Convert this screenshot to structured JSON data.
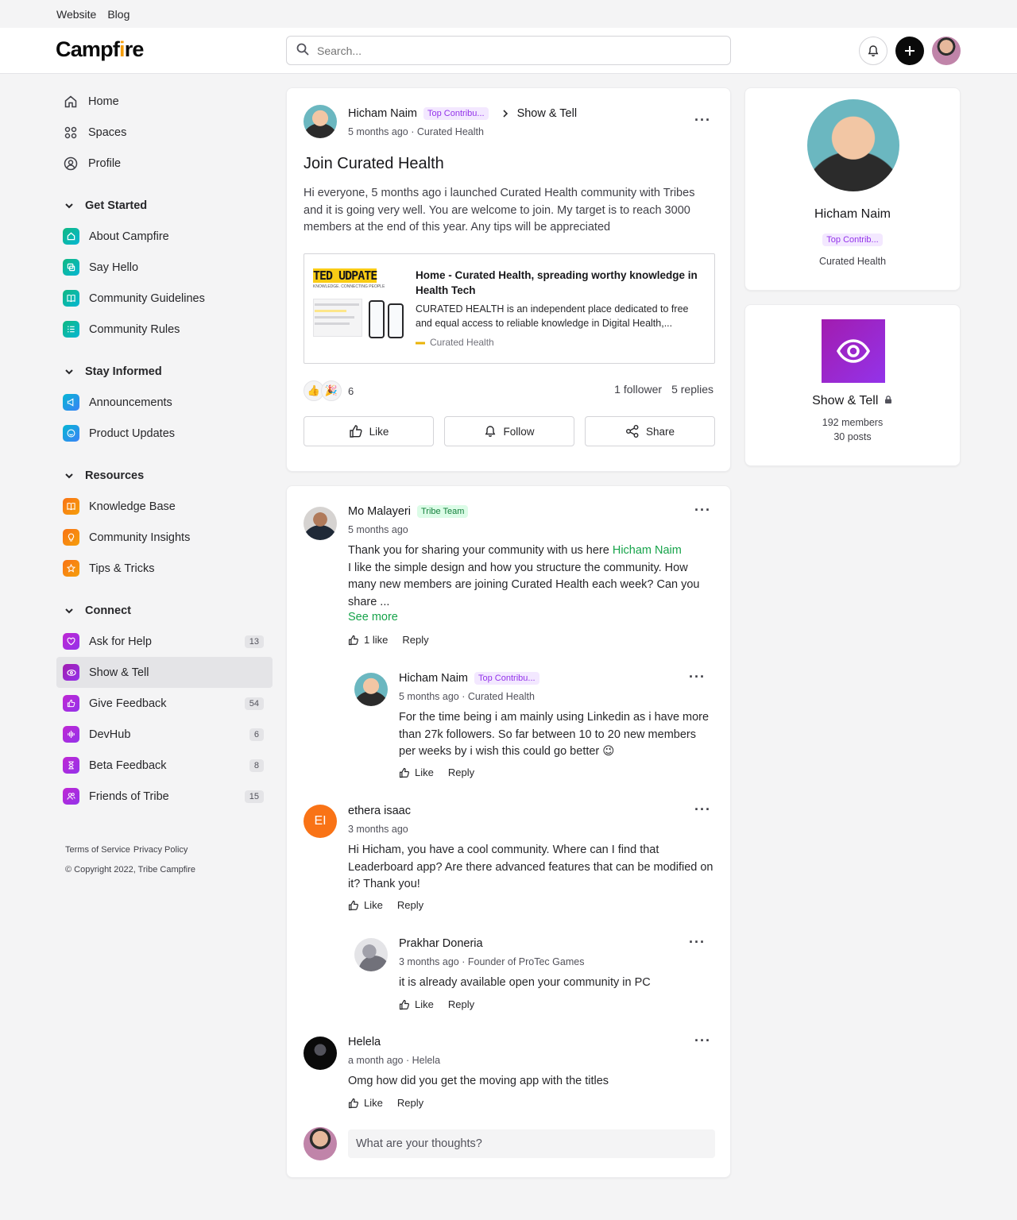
{
  "topnav": {
    "website": "Website",
    "blog": "Blog"
  },
  "header": {
    "logo": "Campfire",
    "search_placeholder": "Search..."
  },
  "sidebar": {
    "main": [
      {
        "label": "Home",
        "icon": "home-icon"
      },
      {
        "label": "Spaces",
        "icon": "grid-icon"
      },
      {
        "label": "Profile",
        "icon": "profile-icon"
      }
    ],
    "sections": [
      {
        "title": "Get Started",
        "items": [
          {
            "label": "About Campfire",
            "color": "#14b8a6"
          },
          {
            "label": "Say Hello",
            "color": "#14b8a6"
          },
          {
            "label": "Community Guidelines",
            "color": "#14b8a6"
          },
          {
            "label": "Community Rules",
            "color": "#14b8a6"
          }
        ]
      },
      {
        "title": "Stay Informed",
        "items": [
          {
            "label": "Announcements",
            "color": "#0ea5e9"
          },
          {
            "label": "Product Updates",
            "color": "#0ea5e9"
          }
        ]
      },
      {
        "title": "Resources",
        "items": [
          {
            "label": "Knowledge Base",
            "color": "#f97316"
          },
          {
            "label": "Community Insights",
            "color": "#f97316"
          },
          {
            "label": "Tips & Tricks",
            "color": "#f97316"
          }
        ]
      },
      {
        "title": "Connect",
        "items": [
          {
            "label": "Ask for Help",
            "count": "13",
            "color": "#c026d3"
          },
          {
            "label": "Show & Tell",
            "color": "#a21caf",
            "active": true
          },
          {
            "label": "Give Feedback",
            "count": "54",
            "color": "#c026d3"
          },
          {
            "label": "DevHub",
            "count": "6",
            "color": "#c026d3"
          },
          {
            "label": "Beta Feedback",
            "count": "8",
            "color": "#c026d3"
          },
          {
            "label": "Friends of Tribe",
            "count": "15",
            "color": "#c026d3"
          }
        ]
      }
    ],
    "footer": {
      "terms": "Terms of Service",
      "privacy": "Privacy Policy",
      "copyright": "© Copyright 2022, Tribe Campfire"
    }
  },
  "post": {
    "author": "Hicham Naim",
    "badge": "Top Contribu...",
    "space": "Show & Tell",
    "meta": "5 months ago · Curated Health",
    "title": "Join Curated Health",
    "body": "Hi everyone, 5 months ago i launched Curated Health community with Tribes and it is going very well. You are welcome to join. My target is to reach 3000 members at the end of this year. Any tips will be appreciated",
    "link": {
      "thumb_title": "TED UDPATE",
      "thumb_sub": "KNOWLEDGE. CONNECTING PEOPLE",
      "title": "Home - Curated Health, spreading worthy knowledge in Health Tech",
      "desc": "CURATED HEALTH is an independent place dedicated to free and equal access to reliable knowledge in Digital Health,...",
      "source": "Curated Health"
    },
    "reaction_count": "6",
    "followers": "1 follower",
    "replies": "5 replies",
    "like": "Like",
    "follow": "Follow",
    "share": "Share"
  },
  "comments": [
    {
      "author": "Mo Malayeri",
      "badge": "Tribe Team",
      "meta": "5 months ago",
      "text_before": "Thank you for sharing your community with us here ",
      "mention": "Hicham Naim",
      "text_after": "I like the simple design and how you structure the community. How many new members are joining Curated Health each week? Can you share ...",
      "see_more": "See more",
      "likes": "1 like",
      "reply": "Reply"
    },
    {
      "author": "Hicham Naim",
      "badge": "Top Contribu...",
      "meta": "5 months ago · Curated Health",
      "text": "For the time being i am mainly using Linkedin as i have more than 27k followers. So far between 10 to 20 new members per weeks by i wish this could go better 😉",
      "like": "Like",
      "reply": "Reply"
    },
    {
      "author": "ethera isaac",
      "initials": "EI",
      "meta": "3 months ago",
      "text": "Hi Hicham, you have a cool community. Where can I find that Leaderboard app? Are there advanced features that can be modified on it? Thank you!",
      "like": "Like",
      "reply": "Reply"
    },
    {
      "author": "Prakhar Doneria",
      "meta": "3 months ago · Founder of ProTec Games",
      "text": "it is already available open your community in PC",
      "like": "Like",
      "reply": "Reply"
    },
    {
      "author": "Helela",
      "meta": "a month ago · Helela",
      "text": "Omg how did you get the moving app with the titles",
      "like": "Like",
      "reply": "Reply"
    }
  ],
  "reply_placeholder": "What are your thoughts?",
  "profile_card": {
    "name": "Hicham Naim",
    "badge": "Top Contrib...",
    "sub": "Curated Health"
  },
  "space_card": {
    "name": "Show & Tell",
    "members": "192 members",
    "posts": "30 posts",
    "color": "#a21caf"
  }
}
